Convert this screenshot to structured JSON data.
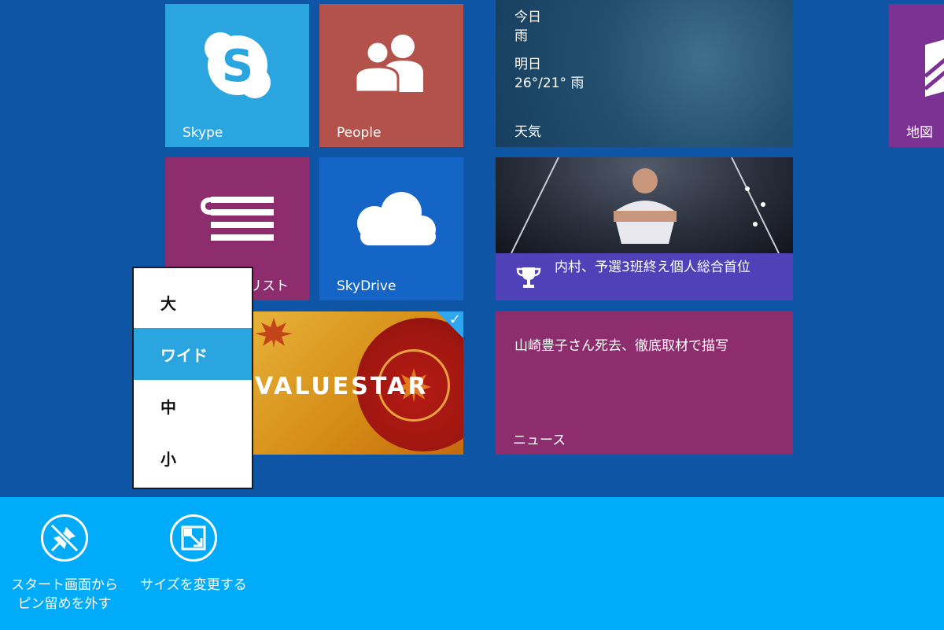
{
  "tiles": {
    "skype": {
      "label": "Skype",
      "color": "#2aa5e0",
      "icon": "skype-icon"
    },
    "people": {
      "label": "People",
      "color": "#b2524a",
      "icon": "people-icon"
    },
    "reading_list": {
      "label": "リスト",
      "color": "#8e2d6e",
      "icon": "reading-list-icon"
    },
    "skydrive": {
      "label": "SkyDrive",
      "color": "#1565c7",
      "icon": "cloud-icon"
    },
    "valuestar": {
      "label": "VALUESTAR",
      "selected": true
    },
    "weather": {
      "today_label": "今日",
      "today_condition": "雨",
      "tomorrow_label": "明日",
      "tomorrow_forecast": "26°/21° 雨",
      "label": "天気"
    },
    "sports": {
      "headline": "内村、予選3班終え個人総合首位",
      "icon": "trophy-icon"
    },
    "news": {
      "headline": "山崎豊子さん死去、徹底取材で描写",
      "label": "ニュース",
      "color": "#8e2d6e"
    },
    "maps": {
      "label": "地図",
      "color": "#7b3292"
    }
  },
  "size_menu": {
    "items": [
      "大",
      "ワイド",
      "中",
      "小"
    ],
    "selected": "ワイド",
    "accent": "#2aa5e0"
  },
  "app_bar": {
    "color": "#00abf9",
    "unpin": {
      "label_line1": "スタート画面から",
      "label_line2": "ピン留めを外す",
      "icon": "unpin-icon"
    },
    "resize": {
      "label": "サイズを変更する",
      "icon": "resize-icon"
    }
  }
}
